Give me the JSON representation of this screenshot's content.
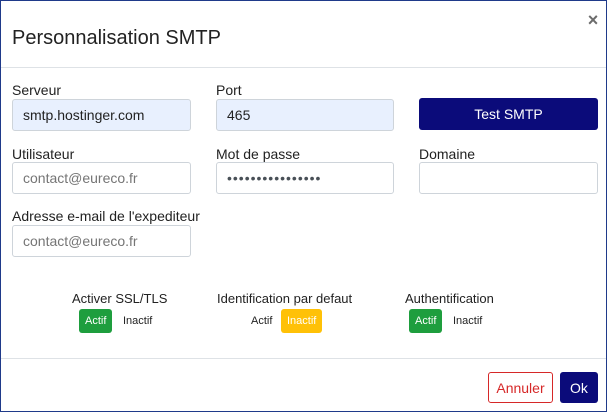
{
  "dialog": {
    "title": "Personnalisation SMTP",
    "close_glyph": "×"
  },
  "form": {
    "server": {
      "label": "Serveur",
      "value": "smtp.hostinger.com"
    },
    "port": {
      "label": "Port",
      "value": "465"
    },
    "test_button": "Test SMTP",
    "user": {
      "label": "Utilisateur",
      "placeholder": "contact@eureco.fr"
    },
    "password": {
      "label": "Mot de passe",
      "value": "••••••••••••••••"
    },
    "domain": {
      "label": "Domaine",
      "placeholder": ""
    },
    "sender": {
      "label": "Adresse e-mail de l'expediteur",
      "placeholder": "contact@eureco.fr"
    }
  },
  "toggles": [
    {
      "label": "Activer SSL/TLS",
      "on": "Actif",
      "off": "Inactif",
      "selected": "on",
      "color": "#1e9e3e"
    },
    {
      "label": "Identification par defaut",
      "on": "Actif",
      "off": "Inactif",
      "selected": "off",
      "color": "#ffc107"
    },
    {
      "label": "Authentification",
      "on": "Actif",
      "off": "Inactif",
      "selected": "on",
      "color": "#1e9e3e"
    }
  ],
  "footer": {
    "cancel": "Annuler",
    "ok": "Ok"
  },
  "colors": {
    "primary": "#0b0b7a",
    "success": "#1e9e3e",
    "warning": "#ffc107",
    "danger": "#d62828",
    "autofill": "#e8f0fe"
  }
}
